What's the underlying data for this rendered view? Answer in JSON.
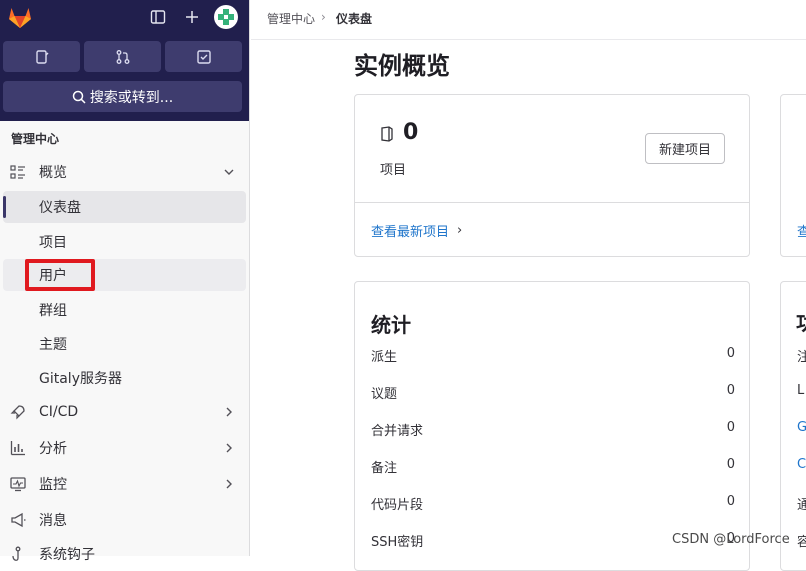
{
  "sidebar": {
    "search_label": "搜索或转到...",
    "section_title": "管理中心",
    "items": [
      {
        "label": "概览"
      },
      {
        "label": "仪表盘"
      },
      {
        "label": "项目"
      },
      {
        "label": "用户"
      },
      {
        "label": "群组"
      },
      {
        "label": "主题"
      },
      {
        "label": "Gitaly服务器"
      },
      {
        "label": "CI/CD"
      },
      {
        "label": "分析"
      },
      {
        "label": "监控"
      },
      {
        "label": "消息"
      },
      {
        "label": "系统钩子"
      }
    ]
  },
  "breadcrumb": {
    "parent": "管理中心",
    "separator": "›",
    "current": "仪表盘"
  },
  "page": {
    "title": "实例概览"
  },
  "projects_card": {
    "count": "0",
    "label": "项目",
    "new_button": "新建项目",
    "link": "查看最新项目",
    "link_arrow": "›"
  },
  "stats_card": {
    "title": "统计",
    "rows": [
      {
        "label": "派生",
        "value": "0"
      },
      {
        "label": "议题",
        "value": "0"
      },
      {
        "label": "合并请求",
        "value": "0"
      },
      {
        "label": "备注",
        "value": "0"
      },
      {
        "label": "代码片段",
        "value": "0"
      },
      {
        "label": "SSH密钥",
        "value": "0"
      }
    ]
  },
  "right_column": {
    "link_fragment": "查",
    "title_fragment": "功",
    "row_fragments": [
      "注",
      "L",
      "G",
      "C",
      "通",
      "容"
    ]
  },
  "watermark": "CSDN @LordForce",
  "colors": {
    "sidebar_header": "#211f4d",
    "link": "#1f75cb",
    "highlight": "#e0191f"
  }
}
